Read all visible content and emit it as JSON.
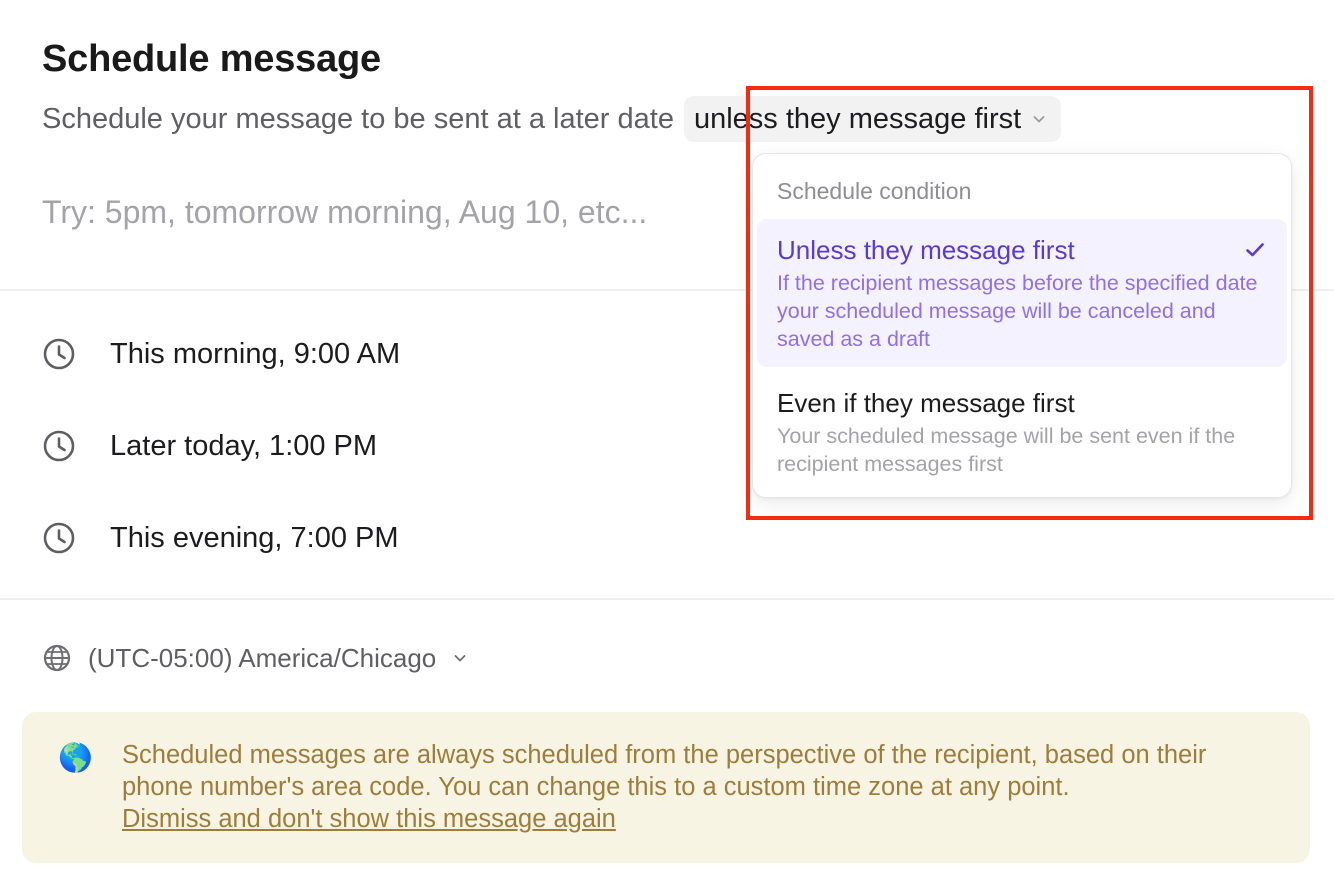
{
  "header": {
    "title": "Schedule message",
    "subtitle": "Schedule your message to be sent at a later date"
  },
  "condition": {
    "selected_label": "unless they message first",
    "icon": "chevron-down-icon"
  },
  "date_input": {
    "value": "",
    "placeholder": "Try: 5pm, tomorrow morning, Aug 10, etc..."
  },
  "quick_options": [
    {
      "label": "This morning, 9:00 AM",
      "icon": "clock-icon"
    },
    {
      "label": "Later today, 1:00 PM",
      "icon": "clock-icon"
    },
    {
      "label": "This evening, 7:00 PM",
      "icon": "clock-icon"
    }
  ],
  "timezone": {
    "label": "(UTC-05:00) America/Chicago",
    "icon": "globe-icon"
  },
  "banner": {
    "emoji": "🌎",
    "text": "Scheduled messages are always scheduled from the perspective of the recipient, based on their phone number's area code. You can change this to a custom time zone at any point.",
    "link": "Dismiss and don't show this message again"
  },
  "dropdown": {
    "heading": "Schedule condition",
    "items": [
      {
        "title": "Unless they message first",
        "description": "If the recipient messages before the specified date your scheduled message will be canceled and saved as a draft",
        "selected": true
      },
      {
        "title": "Even if they message first",
        "description": "Your scheduled message will be sent even if the recipient messages first",
        "selected": false
      }
    ]
  },
  "colors": {
    "accent": "#5a3ad6",
    "accent_light": "#f4f2fe",
    "banner_bg": "#f8f4e3",
    "banner_text": "#9e7d3c",
    "highlight": "#f52a10"
  }
}
